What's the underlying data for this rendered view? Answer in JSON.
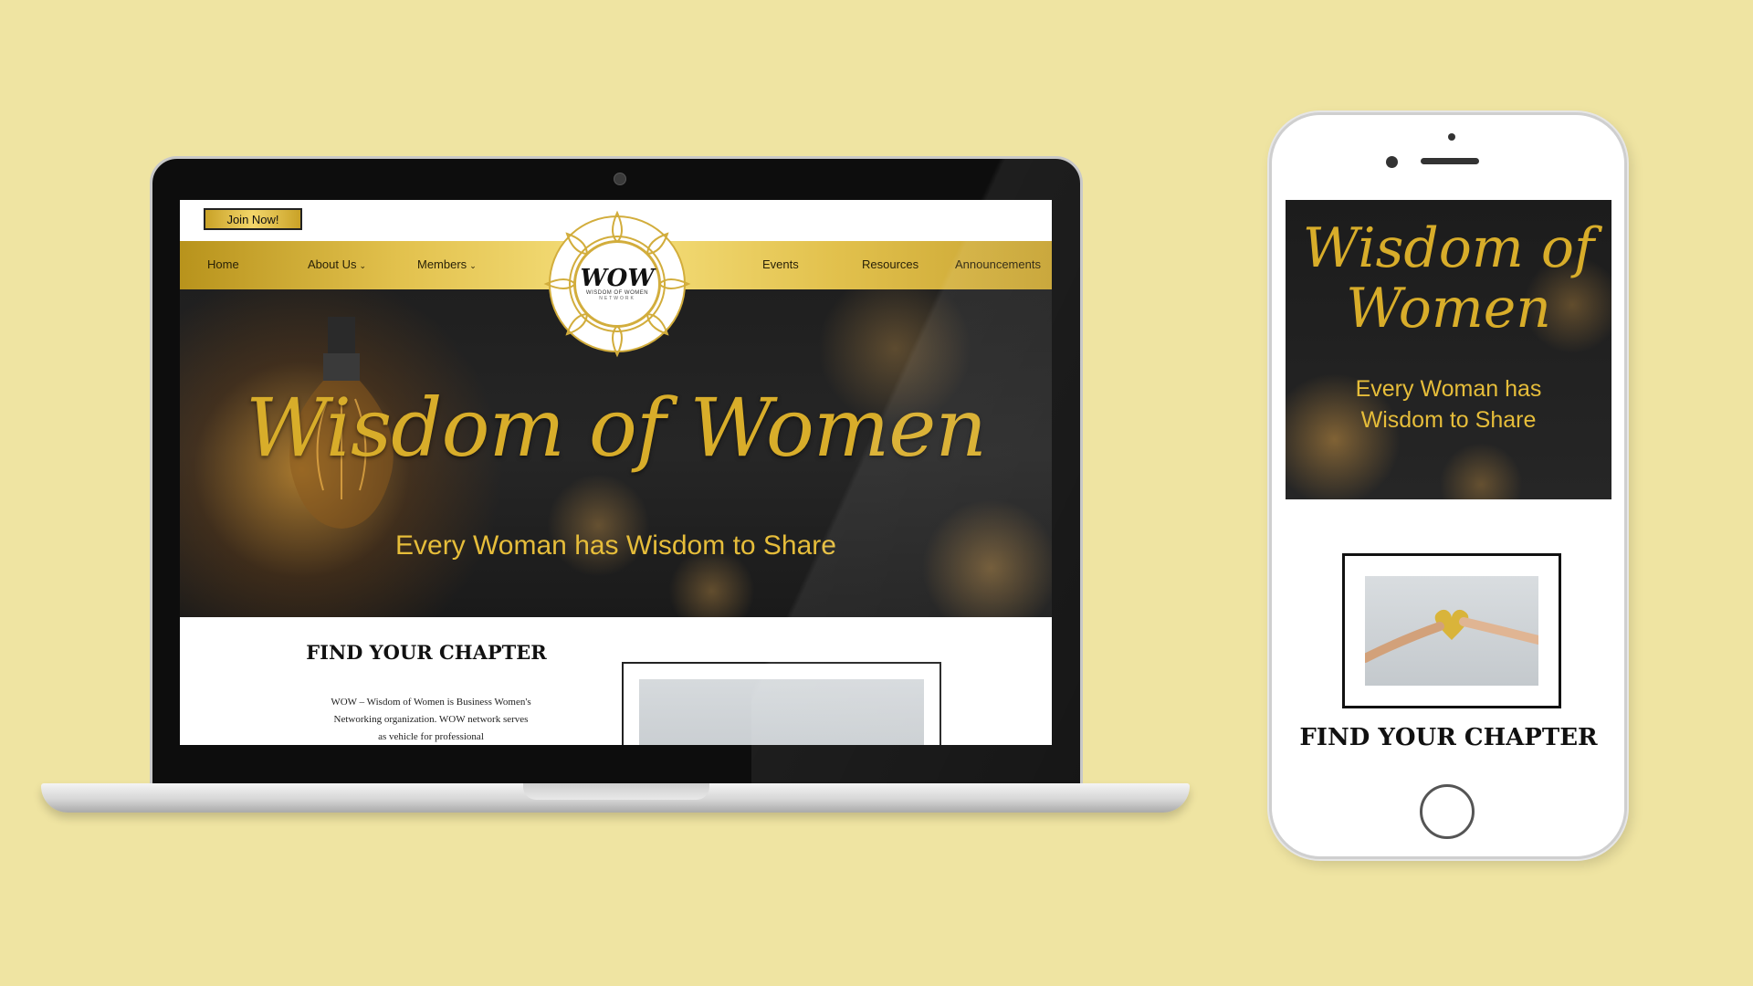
{
  "colors": {
    "background": "#efe4a2",
    "gold": "#d8ad2a",
    "nav_gold": "#e2c14d",
    "dark": "#1f1f1f"
  },
  "desktop": {
    "join_button": "Join Now!",
    "nav": {
      "home": "Home",
      "about": "About Us",
      "members": "Members",
      "events": "Events",
      "resources": "Resources",
      "announcements": "Announcements"
    },
    "logo": {
      "wow": "WOW",
      "line1": "WISDOM OF WOMEN",
      "line2": "NETWORK"
    },
    "hero": {
      "title": "Wisdom of Women",
      "subtitle": "Every Woman has Wisdom to Share"
    },
    "content": {
      "chapter_title": "FIND YOUR CHAPTER",
      "chapter_text": "WOW – Wisdom of Women is Business Women's Networking organization. WOW network serves as vehicle for professional"
    },
    "icons": {
      "dropdown": "chevron-down-icon",
      "hero_image": "light-bulb-icon",
      "photo": "hands-heart-image"
    }
  },
  "mobile": {
    "hero": {
      "title_line1": "Wisdom of",
      "title_line2": "Women",
      "subtitle_line1": "Every Woman has",
      "subtitle_line2": "Wisdom to Share"
    },
    "chapter_title": "FIND YOUR CHAPTER"
  }
}
